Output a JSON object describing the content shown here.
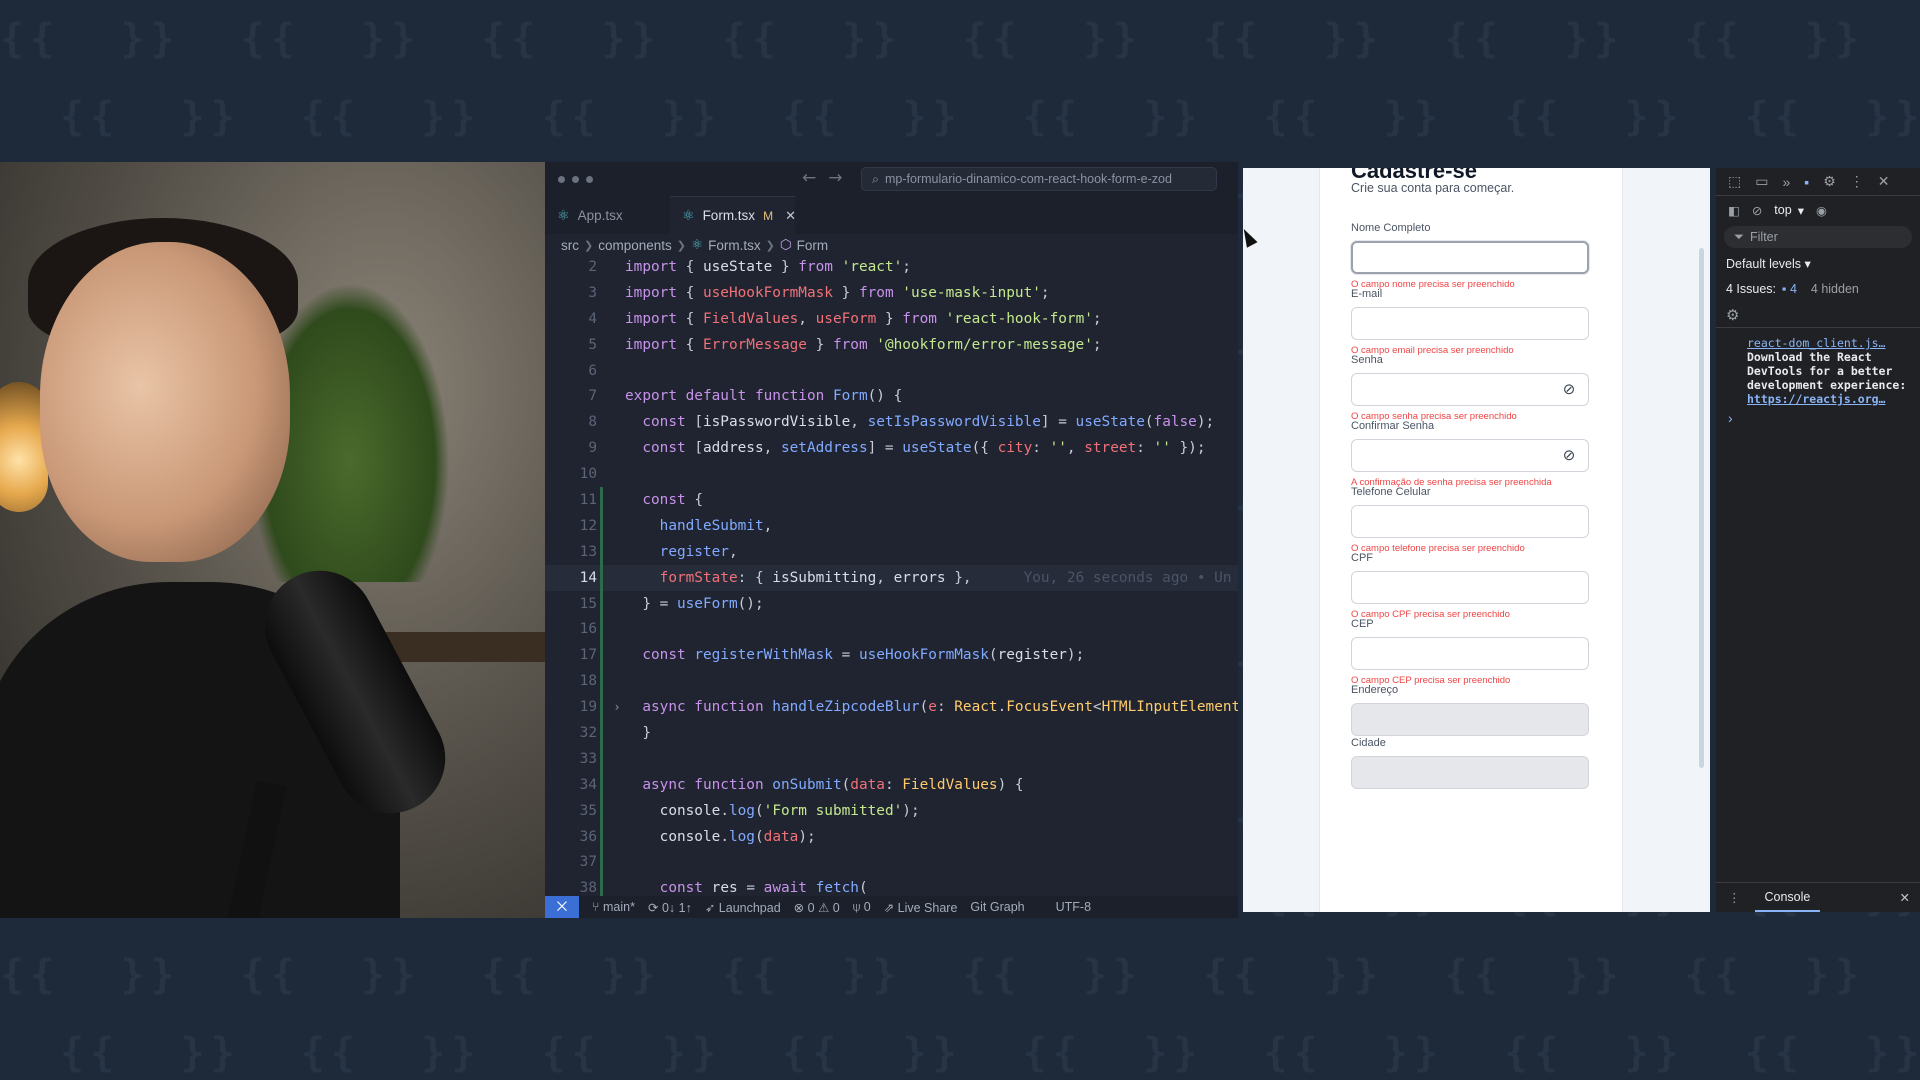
{
  "editor": {
    "search": "mp-formulario-dinamico-com-react-hook-form-e-zod",
    "tabs": [
      {
        "label": "App.tsx"
      },
      {
        "label": "Form.tsx",
        "badge": "M"
      }
    ],
    "breadcrumb": [
      "src",
      "components",
      "Form.tsx",
      "Form"
    ],
    "lines": [
      {
        "n": "2",
        "html": "<span class='kw'>import</span> { <span class='id'>useState</span> } <span class='kw'>from</span> <span class='str'>'react'</span>;"
      },
      {
        "n": "3",
        "html": "<span class='kw'>import</span> { <span class='var'>useHookFormMask</span> } <span class='kw'>from</span> <span class='str'>'use-mask-input'</span>;"
      },
      {
        "n": "4",
        "html": "<span class='kw'>import</span> { <span class='var'>FieldValues</span>, <span class='var'>useForm</span> } <span class='kw'>from</span> <span class='str'>'react-hook-form'</span>;"
      },
      {
        "n": "5",
        "html": "<span class='kw'>import</span> { <span class='var'>ErrorMessage</span> } <span class='kw'>from</span> <span class='str'>'@hookform/error-message'</span>;"
      },
      {
        "n": "6",
        "html": ""
      },
      {
        "n": "7",
        "html": "<span class='kw'>export default function</span> <span class='fn'>Form</span>() {"
      },
      {
        "n": "8",
        "html": "  <span class='kw'>const</span> [<span class='id'>isPasswordVisible</span>, <span class='fn'>setIsPasswordVisible</span>] = <span class='fn'>useState</span>(<span class='kw'>false</span>);"
      },
      {
        "n": "9",
        "html": "  <span class='kw'>const</span> [<span class='id'>address</span>, <span class='fn'>setAddress</span>] = <span class='fn'>useState</span>({ <span class='var'>city</span>: <span class='str'>''</span>, <span class='var'>street</span>: <span class='str'>''</span> });"
      },
      {
        "n": "10",
        "html": ""
      },
      {
        "n": "11",
        "html": "  <span class='kw'>const</span> {"
      },
      {
        "n": "12",
        "html": "    <span class='fn'>handleSubmit</span>,"
      },
      {
        "n": "13",
        "html": "    <span class='fn'>register</span>,"
      },
      {
        "n": "14",
        "html": "    <span class='var'>formState</span>: { <span class='id'>isSubmitting</span>, <span class='id'>errors</span> },      <span class='blame'>You, 26 seconds ago • Un</span>"
      },
      {
        "n": "15",
        "html": "  } = <span class='fn'>useForm</span>();"
      },
      {
        "n": "16",
        "html": ""
      },
      {
        "n": "17",
        "html": "  <span class='kw'>const</span> <span class='fn'>registerWithMask</span> = <span class='fn'>useHookFormMask</span>(<span class='id'>register</span>);"
      },
      {
        "n": "18",
        "html": ""
      },
      {
        "n": "19",
        "html": "  <span class='kw'>async function</span> <span class='fn'>handleZipcodeBlur</span>(<span class='var'>e</span>: <span class='ty'>React</span>.<span class='ty'>FocusEvent</span>&lt;<span class='ty'>HTMLInputElement</span>"
      },
      {
        "n": "32",
        "html": "  }"
      },
      {
        "n": "33",
        "html": ""
      },
      {
        "n": "34",
        "html": "  <span class='kw'>async function</span> <span class='fn'>onSubmit</span>(<span class='var'>data</span>: <span class='ty'>FieldValues</span>) {"
      },
      {
        "n": "35",
        "html": "    <span class='id'>console</span>.<span class='fn'>log</span>(<span class='str'>'Form submitted'</span>);"
      },
      {
        "n": "36",
        "html": "    <span class='id'>console</span>.<span class='fn'>log</span>(<span class='var'>data</span>);"
      },
      {
        "n": "37",
        "html": ""
      },
      {
        "n": "38",
        "html": "    <span class='kw'>const</span> <span class='id'>res</span> = <span class='kw'>await</span> <span class='fn'>fetch</span>("
      }
    ],
    "status": {
      "branch": "main*",
      "sync": "0↓ 1↑",
      "launchpad": "Launchpad",
      "errors": "0",
      "warnings": "0",
      "ports": "0",
      "liveshare": "Live Share",
      "gitgraph": "Git Graph",
      "encoding": "UTF-8"
    }
  },
  "form": {
    "title": "Cadastre-se",
    "subtitle": "Crie sua conta para começar.",
    "fields": [
      {
        "label": "Nome Completo",
        "error": "O campo nome precisa ser preenchido"
      },
      {
        "label": "E-mail",
        "error": "O campo email precisa ser preenchido"
      },
      {
        "label": "Senha",
        "error": "O campo senha precisa ser preenchido"
      },
      {
        "label": "Confirmar Senha",
        "error": "A confirmação de senha precisa ser preenchida"
      },
      {
        "label": "Telefone Celular",
        "error": "O campo telefone precisa ser preenchido"
      },
      {
        "label": "CPF",
        "error": "O campo CPF precisa ser preenchido"
      },
      {
        "label": "CEP",
        "error": "O campo CEP precisa ser preenchido"
      },
      {
        "label": "Endereço"
      },
      {
        "label": "Cidade"
      }
    ]
  },
  "devtools": {
    "context": "top",
    "filter": "Filter",
    "levels": "Default levels ▾",
    "issues_label": "4 Issues:",
    "issues_count": "4",
    "hidden": "4 hidden",
    "message_link": "react-dom_client.js…",
    "message": "Download the React DevTools for a better development experience:",
    "message_url": "https://reactjs.org…",
    "drawer_tab": "Console"
  }
}
